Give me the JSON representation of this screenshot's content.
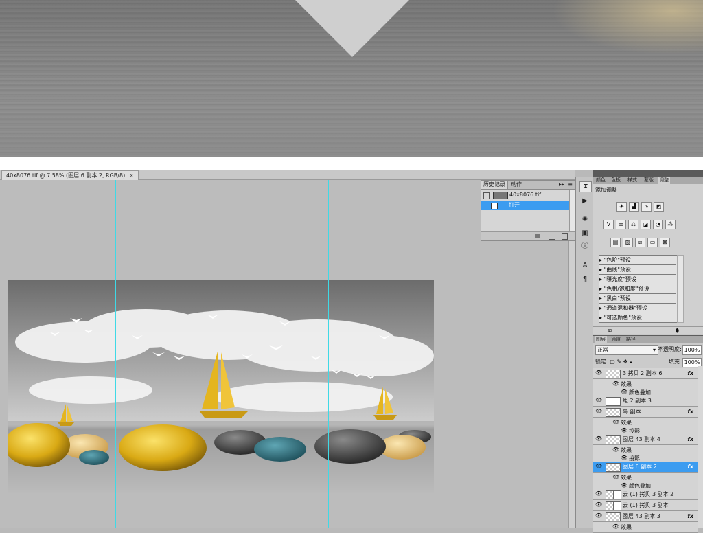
{
  "document": {
    "tab_title": "40x8076.tif @ 7.58% (图层 6 副本 2, RGB/8)",
    "close_glyph": "×"
  },
  "history_panel": {
    "tabs": [
      "历史记录",
      "动作"
    ],
    "snapshot_name": "40x8076.tif",
    "items": [
      "打开"
    ]
  },
  "adjustments_panel": {
    "tabs": [
      "颜色",
      "色板",
      "样式",
      "蒙版",
      "调整"
    ],
    "title": "添加调整",
    "presets": [
      "\"色阶\"预设",
      "\"曲线\"预设",
      "\"曝光度\"预设",
      "\"色相/饱和度\"预设",
      "\"黑白\"预设",
      "\"通道混和器\"预设",
      "\"可选颜色\"预设"
    ]
  },
  "layers_panel": {
    "tabs": [
      "图层",
      "通道",
      "路径"
    ],
    "blend_mode": "正常",
    "opacity_label": "不透明度:",
    "opacity_value": "100%",
    "lock_label": "锁定:",
    "fill_label": "填充:",
    "fill_value": "100%",
    "rows": [
      {
        "name": "3 拷贝 2 副本 6",
        "kind": "layer",
        "fx": "fx"
      },
      {
        "name": "效果",
        "kind": "effects"
      },
      {
        "name": "颜色叠加",
        "kind": "effect"
      },
      {
        "name": "组 2 副本 3",
        "kind": "group"
      },
      {
        "name": "鸟 副本",
        "kind": "layer",
        "fx": "fx"
      },
      {
        "name": "效果",
        "kind": "effects"
      },
      {
        "name": "投影",
        "kind": "effect"
      },
      {
        "name": "图层 43 副本 4",
        "kind": "layer",
        "fx": "fx"
      },
      {
        "name": "效果",
        "kind": "effects"
      },
      {
        "name": "投影",
        "kind": "effect"
      },
      {
        "name": "图层 6 副本 2",
        "kind": "layer",
        "fx": "fx",
        "selected": true
      },
      {
        "name": "效果",
        "kind": "effects"
      },
      {
        "name": "颜色叠加",
        "kind": "effect"
      },
      {
        "name": "云 (1) 拷贝 3 副本 2",
        "kind": "layer"
      },
      {
        "name": "云 (1) 拷贝 3 副本",
        "kind": "layer"
      },
      {
        "name": "图层 43 副本 3",
        "kind": "layer",
        "fx": "fx"
      },
      {
        "name": "效果",
        "kind": "effects"
      }
    ]
  },
  "colors": {
    "accent_selection": "#3c9cf0",
    "guide": "#3fd9e6",
    "gold": "#e2b51d",
    "teal": "#2f7d8c"
  }
}
